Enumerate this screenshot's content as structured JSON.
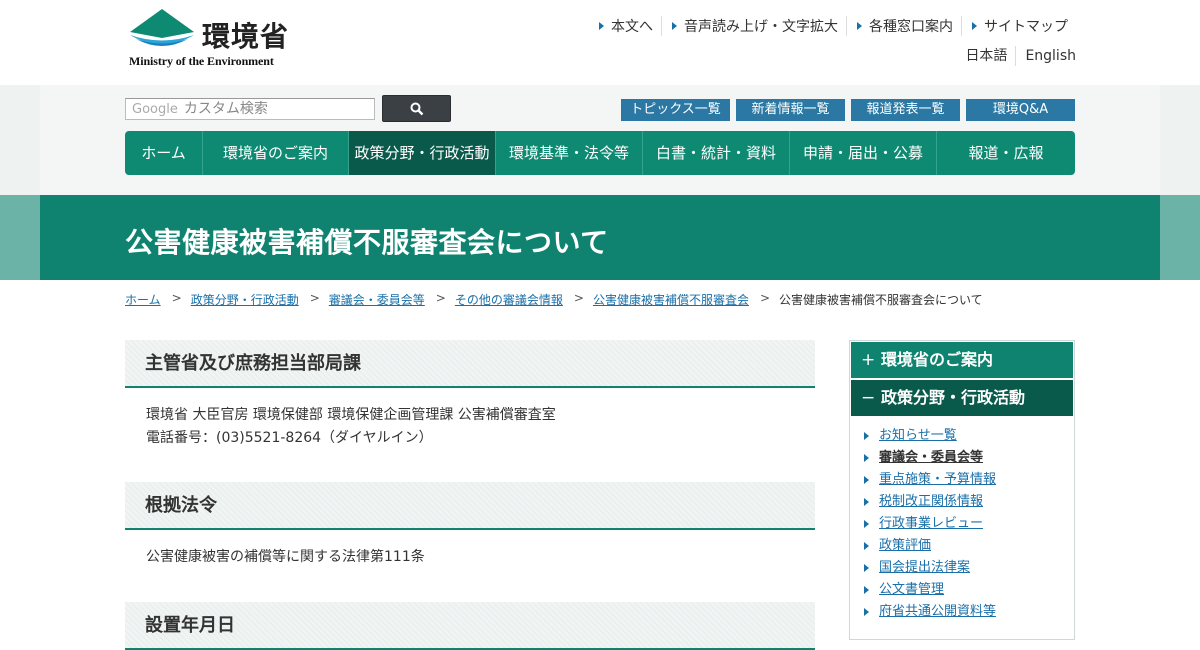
{
  "header": {
    "logo_jp": "環境省",
    "logo_en": "Ministry of the Environment",
    "util_links": [
      "本文へ",
      "音声読み上げ・文字拡大",
      "各種窓口案内",
      "サイトマップ"
    ],
    "lang_links": [
      "日本語",
      "English"
    ]
  },
  "search": {
    "google_label": "Google",
    "placeholder": "カスタム検索"
  },
  "top_buttons": [
    "トピックス一覧",
    "新着情報一覧",
    "報道発表一覧",
    "環境Q&A"
  ],
  "nav": {
    "items": [
      {
        "label": "ホーム"
      },
      {
        "label": "環境省のご案内"
      },
      {
        "label": "政策分野・行政活動"
      },
      {
        "label": "環境基準・法令等"
      },
      {
        "label": "白書・統計・資料"
      },
      {
        "label": "申請・届出・公募"
      },
      {
        "label": "報道・広報"
      }
    ],
    "active": "政策分野・行政活動"
  },
  "page_title": "公害健康被害補償不服審査会について",
  "breadcrumb": {
    "links": [
      "ホーム",
      "政策分野・行政活動",
      "審議会・委員会等",
      "その他の審議会情報",
      "公害健康被害補償不服審査会"
    ],
    "current": "公害健康被害補償不服審査会について",
    "separator": ">"
  },
  "sections": [
    {
      "heading": "主管省及び庶務担当部局課",
      "lines": [
        "環境省 大臣官房 環境保健部 環境保健企画管理課 公害補償審査室",
        "電話番号：(03)5521-8264（ダイヤルイン）"
      ]
    },
    {
      "heading": "根拠法令",
      "lines": [
        "公害健康被害の補償等に関する法律第111条"
      ]
    },
    {
      "heading": "設置年月日",
      "lines": []
    }
  ],
  "sidebar": {
    "head1": {
      "symbol": "+",
      "label": "環境省のご案内"
    },
    "head2": {
      "symbol": "−",
      "label": "政策分野・行政活動"
    },
    "items": [
      {
        "label": "お知らせ一覧"
      },
      {
        "label": "審議会・委員会等"
      },
      {
        "label": "重点施策・予算情報"
      },
      {
        "label": "税制改正関係情報"
      },
      {
        "label": "行政事業レビュー"
      },
      {
        "label": "政策評価"
      },
      {
        "label": "国会提出法律案"
      },
      {
        "label": "公文書管理"
      },
      {
        "label": "府省共通公開資料等"
      }
    ],
    "current": "審議会・委員会等"
  },
  "colors": {
    "brand_green": "#0f8370",
    "nav_active": "#0a5a4b",
    "link_blue": "#1a6fa8",
    "button_blue": "#2a78a3"
  }
}
